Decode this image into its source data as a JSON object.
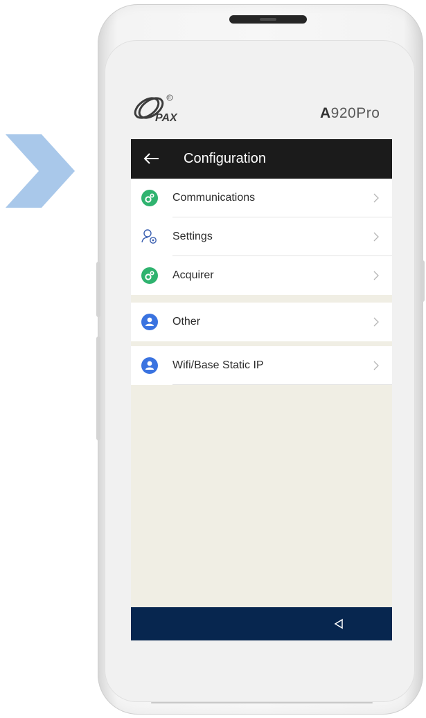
{
  "device": {
    "brand": "PAX",
    "model_prefix": "A",
    "model_suffix": "920Pro"
  },
  "header": {
    "title": "Configuration"
  },
  "menu": {
    "group1": [
      {
        "label": "Communications",
        "icon": "gears-icon",
        "icon_color": "#2fb36f"
      },
      {
        "label": "Settings",
        "icon": "user-settings-icon",
        "icon_color": "#3a5fb0"
      },
      {
        "label": "Acquirer",
        "icon": "gears-icon",
        "icon_color": "#2fb36f"
      }
    ],
    "group2": [
      {
        "label": "Other",
        "icon": "person-icon",
        "icon_color": "#3a73e0"
      }
    ],
    "group3": [
      {
        "label": "Wifi/Base Static IP",
        "icon": "person-icon",
        "icon_color": "#3a73e0"
      }
    ]
  },
  "colors": {
    "titlebar": "#1b1b1b",
    "navbar": "#07264f",
    "screen_bg": "#f0eee4",
    "chevron_arrow": "#a9c8ea"
  }
}
